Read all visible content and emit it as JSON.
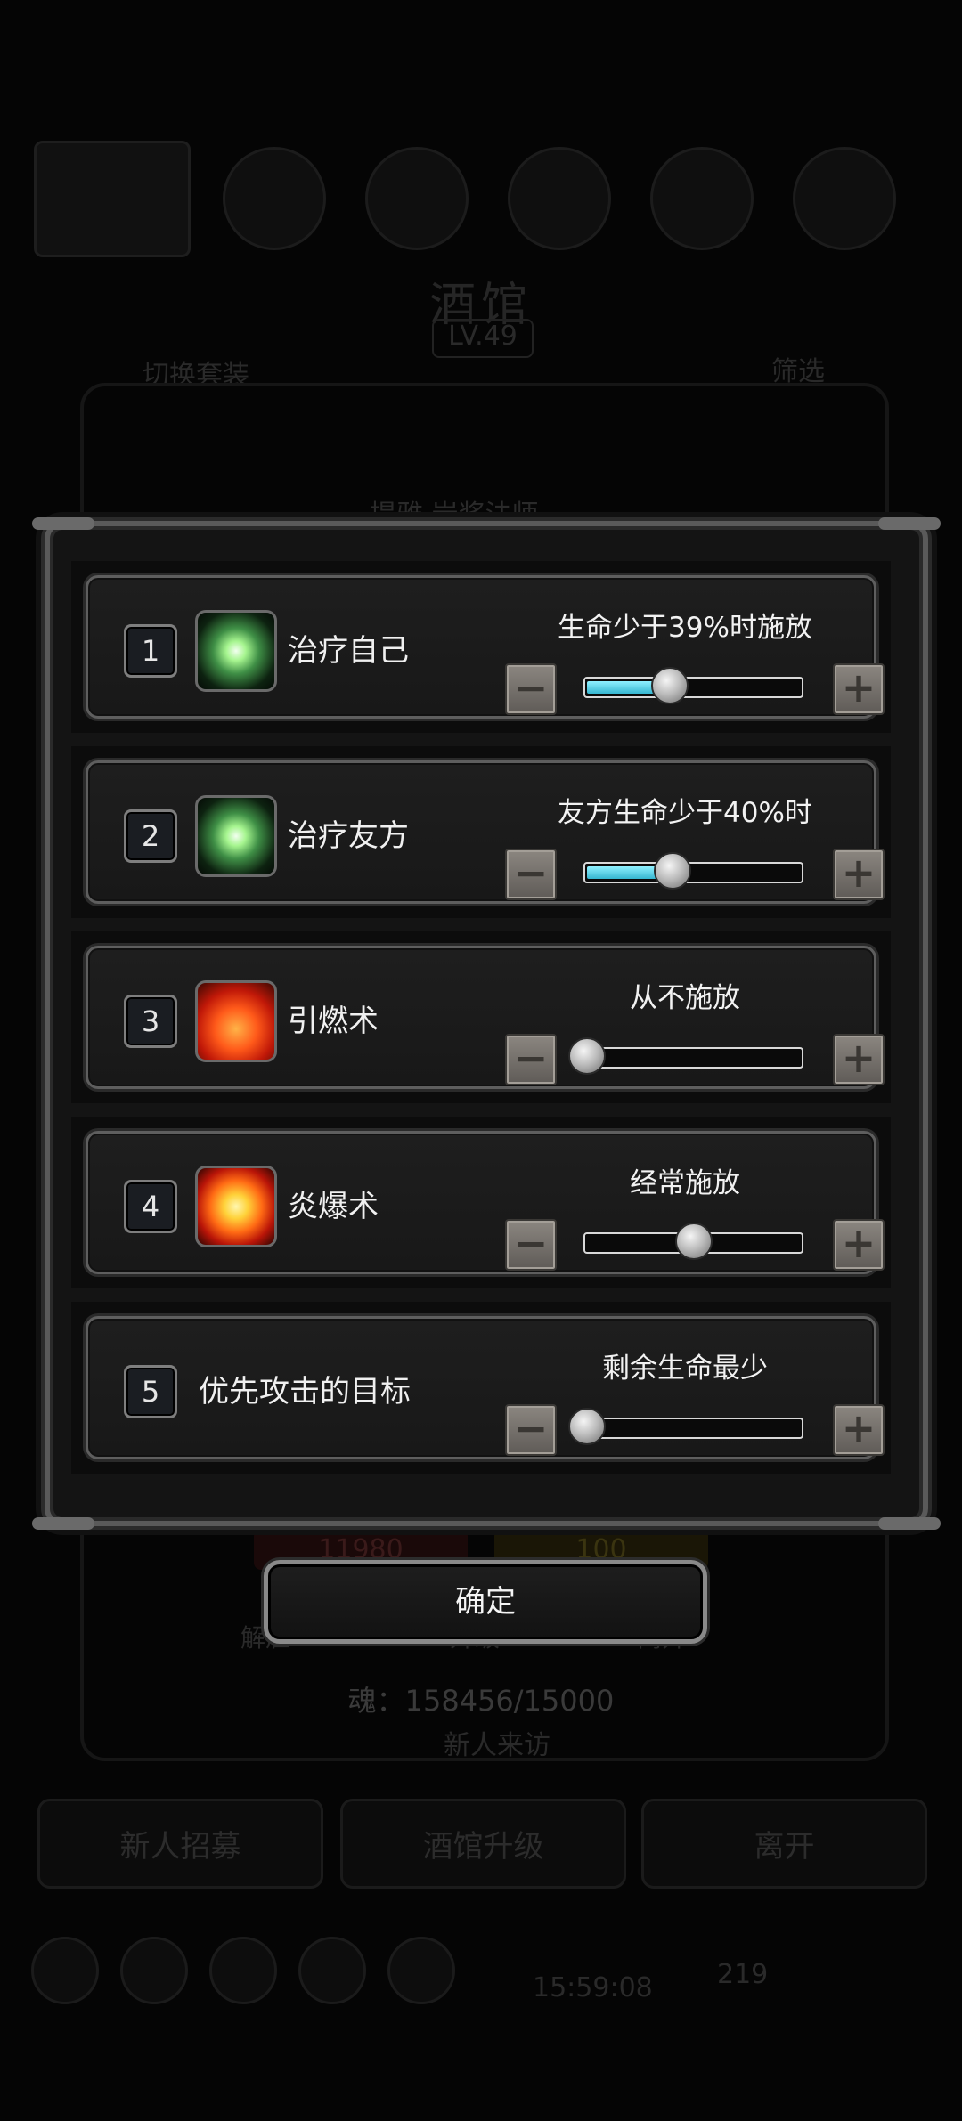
{
  "background": {
    "title": "酒馆",
    "level": "LV.49",
    "switch_label": "切换套装",
    "filter_label": "筛选",
    "hero_label": "提雅·岩浆法师",
    "hp_value": "11980",
    "energy_value": "100",
    "tabs": [
      "解雇",
      "升级",
      "离开"
    ],
    "soul": "魂：158456/15000",
    "new_arrival": "新人来访",
    "buttons": [
      "新人招募",
      "酒馆升级",
      "离开"
    ],
    "timer": "15:59:08",
    "coin": "219"
  },
  "dialog": {
    "rows": [
      {
        "index": "1",
        "icon": "heal-icon",
        "name": "治疗自己",
        "condition": "生命少于39%时施放",
        "level": 0.39,
        "filled": true
      },
      {
        "index": "2",
        "icon": "heal-icon",
        "name": "治疗友方",
        "condition": "友方生命少于40%时",
        "level": 0.4,
        "filled": true
      },
      {
        "index": "3",
        "icon": "fire-icon",
        "name": "引燃术",
        "condition": "从不施放",
        "level": 0.0,
        "filled": false
      },
      {
        "index": "4",
        "icon": "blast-icon",
        "name": "炎爆术",
        "condition": "经常施放",
        "level": 0.5,
        "filled": false
      },
      {
        "index": "5",
        "icon": "",
        "name": "优先攻击的目标",
        "condition": "剩余生命最少",
        "level": 0.0,
        "filled": false
      }
    ],
    "minus_glyph": "−",
    "plus_glyph": "+",
    "confirm_label": "确定"
  },
  "colors": {
    "slider_fill": "#36b7d1",
    "frame": "#5a5a5a",
    "background": "#050505"
  }
}
